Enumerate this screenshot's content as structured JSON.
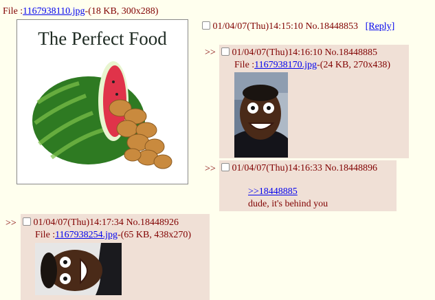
{
  "op": {
    "file_label": "File :",
    "file_link": "1167938110.jpg",
    "file_meta": "-(18 KB, 300x288)",
    "image_caption": "The Perfect Food",
    "datetime": "01/04/07(Thu)14:15:10",
    "post_no": "No.18448853",
    "reply_link": "[Reply]"
  },
  "replies": [
    {
      "arrow": ">>",
      "datetime": "01/04/07(Thu)14:16:10",
      "post_no": "No.18448885",
      "file_label": "File :",
      "file_link": "1167938170.jpg",
      "file_meta": "-(24 KB, 270x438)"
    },
    {
      "arrow": ">>",
      "datetime": "01/04/07(Thu)14:16:33",
      "post_no": "No.18448896",
      "quote_link": ">>18448885",
      "comment": "dude, it's behind you"
    },
    {
      "arrow": ">>",
      "datetime": "01/04/07(Thu)14:17:34",
      "post_no": "No.18448926",
      "file_label": "File :",
      "file_link": "1167938254.jpg",
      "file_meta": "-(65 KB, 438x270)"
    }
  ],
  "colors": {
    "background": "#ffffee",
    "reply_background": "#f0e0d6",
    "text": "#800000",
    "link": "#0000ee"
  }
}
